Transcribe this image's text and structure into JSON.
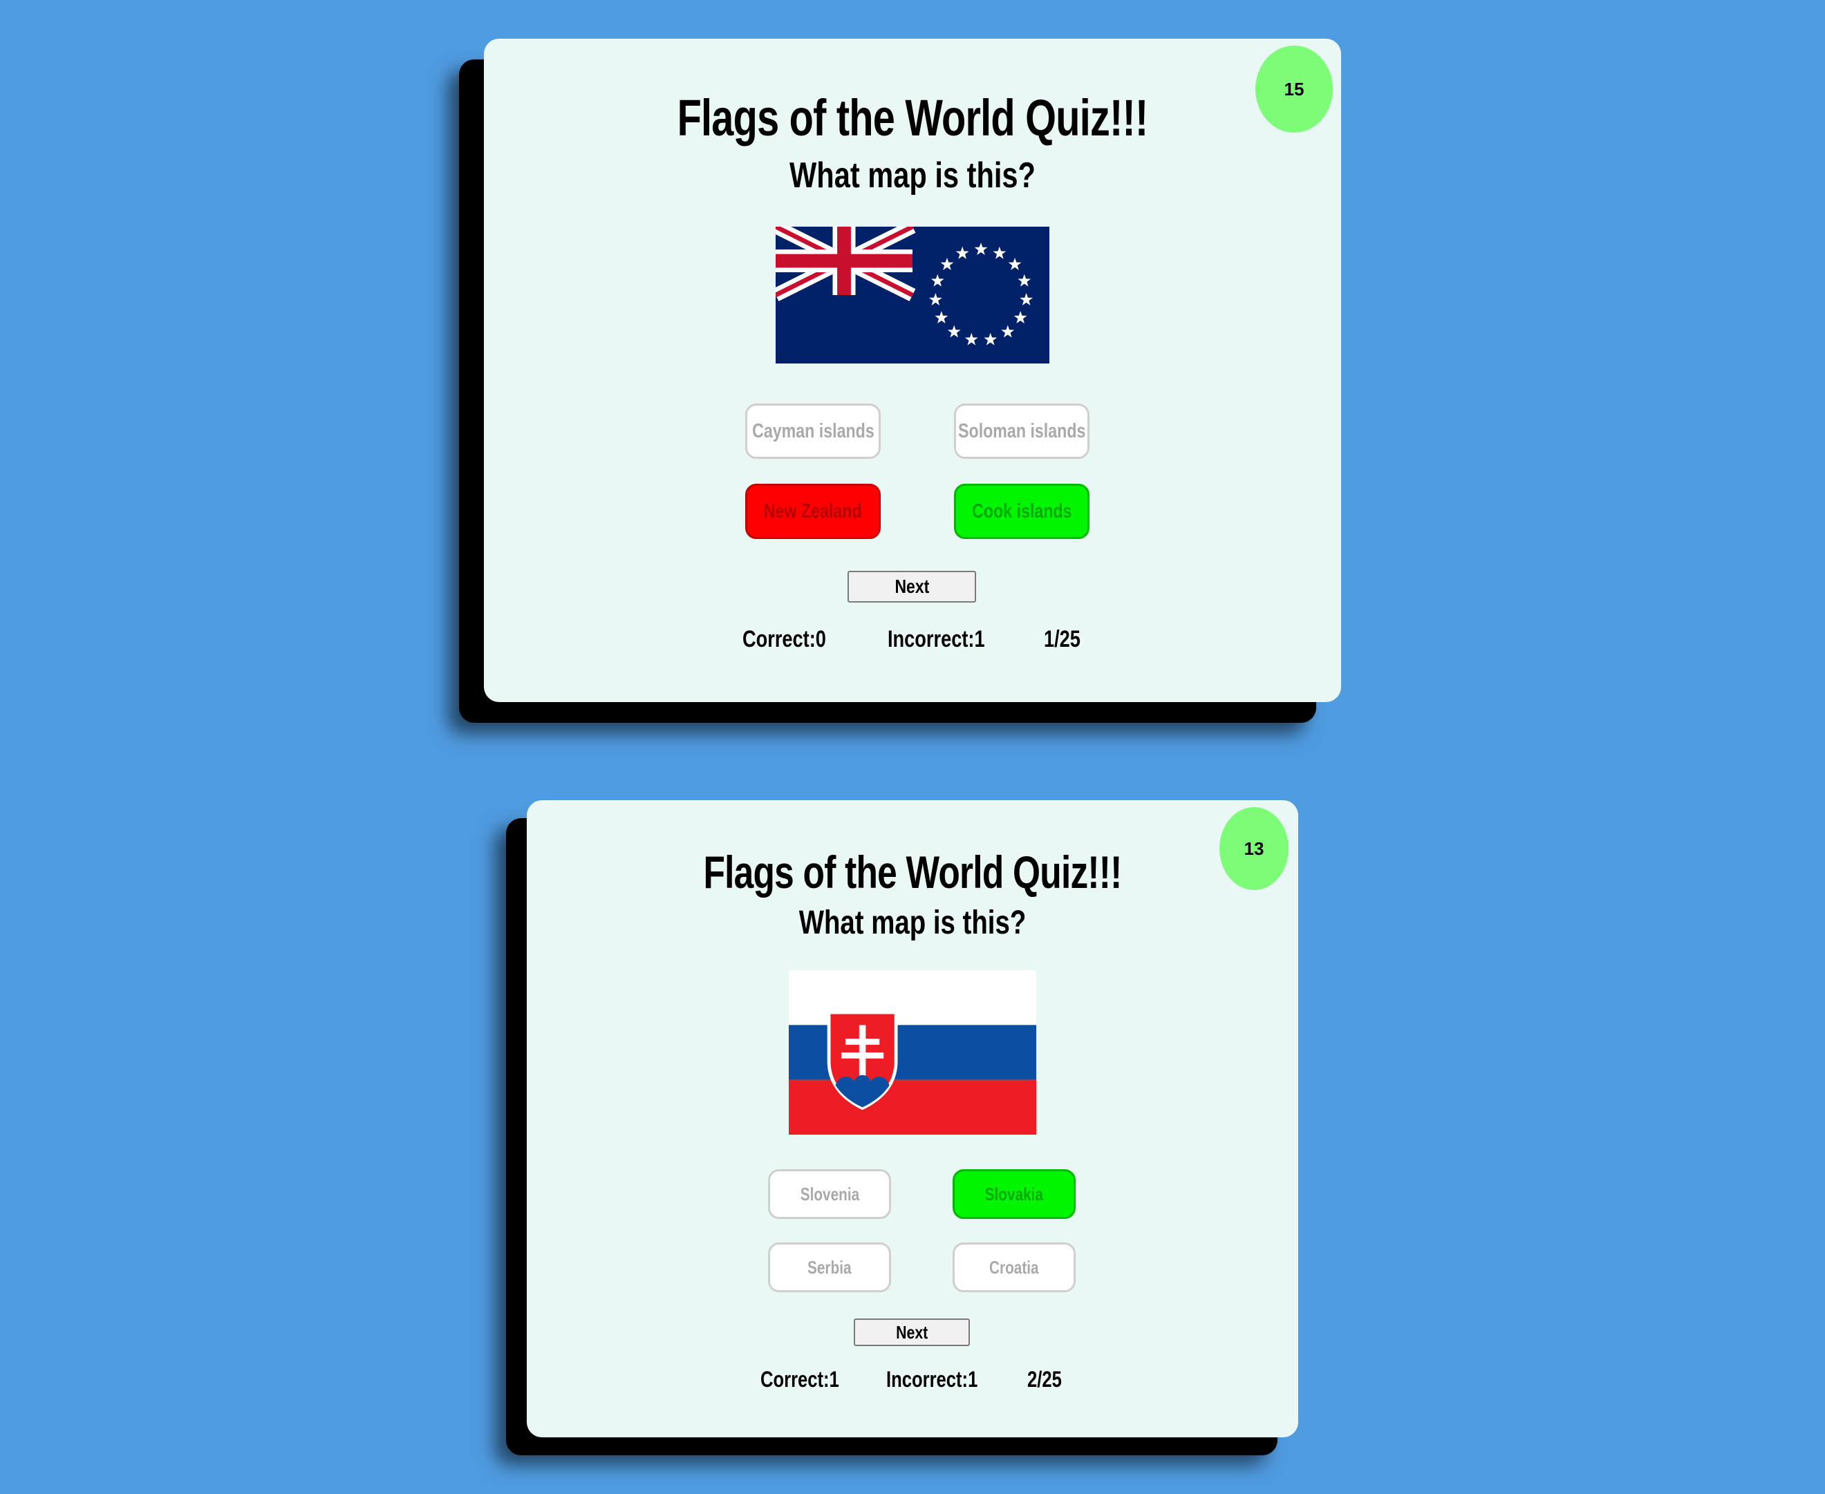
{
  "colors": {
    "background": "#4f9be0",
    "card": "#e9f7f5",
    "timer": "#7dfc78",
    "wrong_answer": "#ff0000",
    "correct_answer": "#00f500"
  },
  "screens": [
    {
      "timer": "15",
      "title": "Flags of the World Quiz!!!",
      "question": "What map is this?",
      "flag_icon": "cook-islands-flag",
      "answers": [
        {
          "label": "Cayman islands",
          "state": "neutral"
        },
        {
          "label": "Soloman islands",
          "state": "neutral"
        },
        {
          "label": "New Zealand",
          "state": "wrong"
        },
        {
          "label": "Cook islands",
          "state": "correct"
        }
      ],
      "next_label": "Next",
      "correct": "Correct:0",
      "incorrect": "Incorrect:1",
      "progress": "1/25"
    },
    {
      "timer": "13",
      "title": "Flags of the World Quiz!!!",
      "question": "What map is this?",
      "flag_icon": "slovakia-flag",
      "answers": [
        {
          "label": "Slovenia",
          "state": "neutral"
        },
        {
          "label": "Slovakia",
          "state": "correct"
        },
        {
          "label": "Serbia",
          "state": "neutral"
        },
        {
          "label": "Croatia",
          "state": "neutral"
        }
      ],
      "next_label": "Next",
      "correct": "Correct:1",
      "incorrect": "Incorrect:1",
      "progress": "2/25"
    }
  ]
}
